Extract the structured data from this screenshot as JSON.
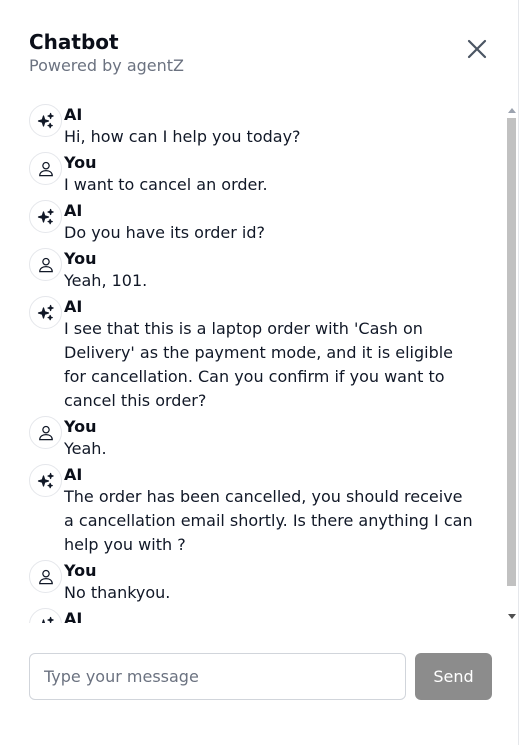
{
  "header": {
    "title": "Chatbot",
    "subtitle": "Powered by agentZ"
  },
  "icons": {
    "ai": "sparkles-icon",
    "user": "user-icon",
    "close": "close-icon"
  },
  "messages": [
    {
      "role": "AI",
      "text": "Hi, how can I help you today?"
    },
    {
      "role": "You",
      "text": "I want to cancel an order."
    },
    {
      "role": "AI",
      "text": "Do you have its order id?"
    },
    {
      "role": "You",
      "text": "Yeah, 101."
    },
    {
      "role": "AI",
      "text": "I see that this is a laptop order with 'Cash on Delivery' as the payment mode, and it is eligible for cancellation. Can you confirm if you want to cancel this order?"
    },
    {
      "role": "You",
      "text": "Yeah."
    },
    {
      "role": "AI",
      "text": "The order has been cancelled, you should receive a cancellation email shortly. Is there anything I can help you with ?"
    },
    {
      "role": "You",
      "text": "No thankyou."
    },
    {
      "role": "AI",
      "text": ""
    }
  ],
  "composer": {
    "placeholder": "Type your message",
    "value": "",
    "send_label": "Send"
  },
  "colors": {
    "send_button": "#8c8c8c",
    "scroll_thumb": "#c1c1c1"
  }
}
